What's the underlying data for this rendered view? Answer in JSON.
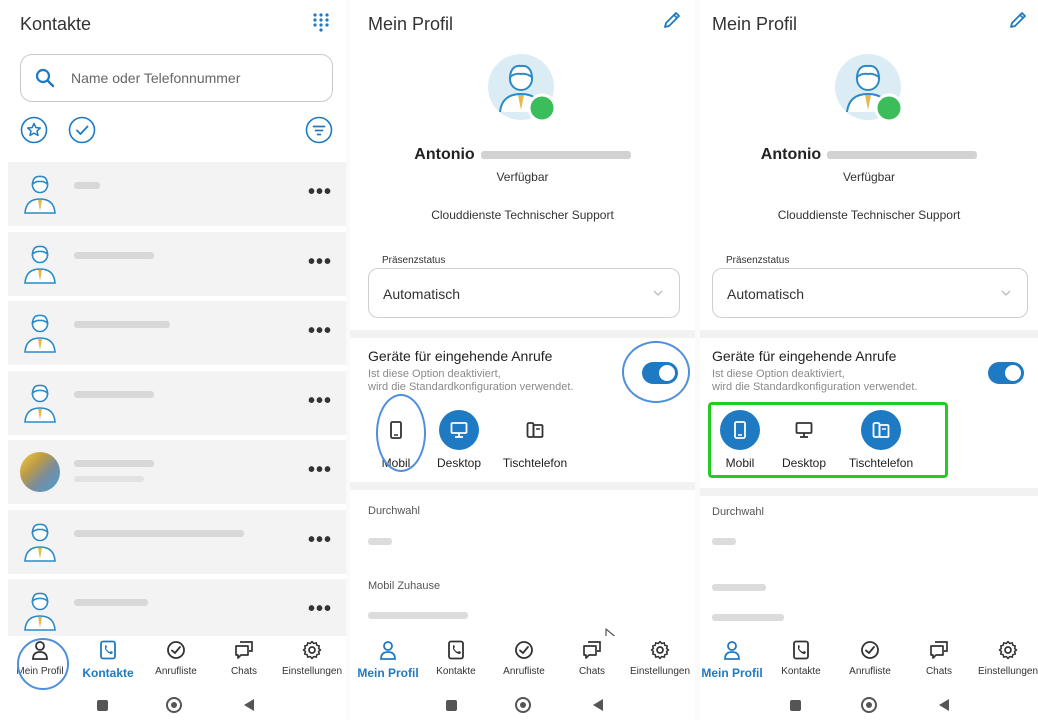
{
  "contacts": {
    "title": "Kontakte",
    "search_placeholder": "Name oder Telefonnummer",
    "rows": [
      {
        "kind": "avatar"
      },
      {
        "kind": "avatar"
      },
      {
        "kind": "avatar"
      },
      {
        "kind": "avatar"
      },
      {
        "kind": "photo"
      },
      {
        "kind": "avatar"
      },
      {
        "kind": "avatar"
      }
    ],
    "more_label": "•••"
  },
  "profile": {
    "title": "Mein Profil",
    "first_name": "Antonio",
    "status": "Verfügbar",
    "department": "Clouddienste Technischer Support",
    "presence_label": "Präsenzstatus",
    "presence_value": "Automatisch",
    "devices_heading": "Geräte für eingehende Anrufe",
    "devices_note_1": "Ist diese Option deaktiviert,",
    "devices_note_2": "wird die Standardkonfiguration verwendet.",
    "device_mobile": "Mobil",
    "device_desktop": "Desktop",
    "device_deskphone": "Tischtelefon",
    "extension_label": "Durchwahl",
    "home_mobile_label": "Mobil Zuhause"
  },
  "nav": {
    "my_profile": "Mein Profil",
    "contacts": "Kontakte",
    "call_list": "Anrufliste",
    "chats": "Chats",
    "settings": "Einstellungen"
  },
  "colors": {
    "accent": "#1d7ac3",
    "presence_green": "#3bbd5b",
    "annotation_blue": "#4f8fdc",
    "annotation_green": "#22cc22"
  },
  "state": {
    "panel2_devices_on": {
      "mobile": false,
      "desktop": true,
      "deskphone": false
    },
    "panel3_devices_on": {
      "mobile": true,
      "desktop": false,
      "deskphone": true
    }
  }
}
